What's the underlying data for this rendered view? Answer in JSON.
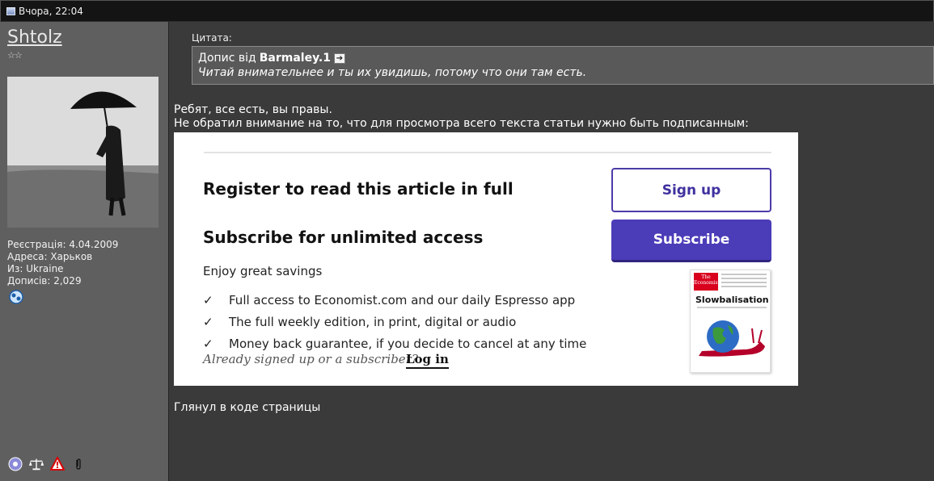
{
  "post": {
    "date": "Вчора, 22:04"
  },
  "user": {
    "name": "Shtolz",
    "rank_stars": "☆☆",
    "registration": "Реєстрація: 4.04.2009",
    "address": "Адреса: Харьков",
    "from": "Из: Ukraine",
    "posts": "Дописів: 2,029"
  },
  "quote": {
    "label": "Цитата:",
    "prefix": "Допис від",
    "author": "Barmaley.1",
    "text": "Читай внимательнее и ты их увидишь, потому что они там есть."
  },
  "message": {
    "line1": "Ребят, все есть, вы правы.",
    "line2": "Не обратил внимание на то, что для просмотра всего текста статьи нужно быть подписанным:",
    "after": "Глянул в коде страницы"
  },
  "embed": {
    "register_heading": "Register to read this article in full",
    "subscribe_heading": "Subscribe for unlimited access",
    "savings": "Enjoy great savings",
    "benefits": [
      "Full access to Economist.com and our daily Espresso app",
      "The full weekly edition, in print, digital or audio",
      "Money back guarantee, if you decide to cancel at any time"
    ],
    "already": "Already signed up or a subscriber?",
    "login": "Log in",
    "signup_button": "Sign up",
    "subscribe_button": "Subscribe",
    "cover_masthead": "The Economist",
    "cover_title": "Slowbalisation",
    "accent_color": "#4b3cb8"
  },
  "icons": [
    "post-icon",
    "badge-icon",
    "status-icon",
    "scales-icon",
    "warning-icon",
    "attachment-icon",
    "quote-link-icon",
    "check-icon"
  ]
}
